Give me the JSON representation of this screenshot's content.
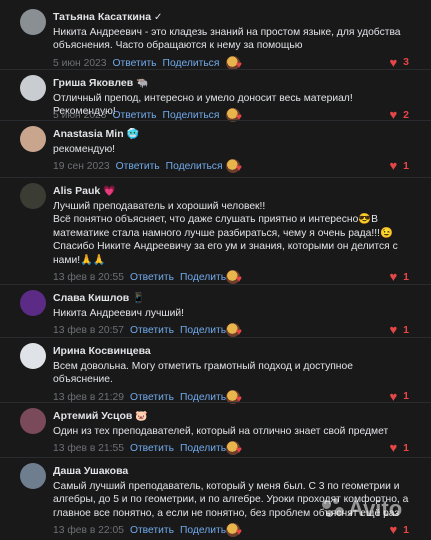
{
  "actions": {
    "reply": "Ответить",
    "share": "Поделиться"
  },
  "comments": [
    {
      "name": "Татьяна Касаткина",
      "name_emoji": "✓",
      "text": [
        "Никита Андреевич - это кладезь знаний на простом языке, для удобства",
        "объяснения. Часто обращаются к нему за помощью"
      ],
      "date": "5 июн 2023",
      "likes": "3",
      "avatar_color": "#8a8f94"
    },
    {
      "name": "Гриша Яковлев",
      "name_emoji": "🐃",
      "text": [
        "Отличный препод, интересно и умело доносит весь материал! Рекомендую!"
      ],
      "date": "5 июн 2023",
      "likes": "2",
      "avatar_color": "#c9cdd2"
    },
    {
      "name": "Anastasia Min",
      "name_emoji": "🥶",
      "text": [
        "рекомендую!"
      ],
      "date": "19 сен 2023",
      "likes": "1",
      "avatar_color": "#caa58e"
    },
    {
      "name": "Alis Pauk",
      "name_emoji": "💗",
      "text": [
        "Лучший преподаватель и хороший человек!!",
        "Всё понятно объясняет, что даже слушать приятно и интересно😎В",
        "математике стала намного лучше разбираться, чему я очень рада!!!😉",
        "Спасибо Никите Андреевичу за его ум и знания, которыми он делится с",
        "нами!🙏🙏"
      ],
      "date": "13 фев в 20:55",
      "likes": "1",
      "avatar_color": "#3b3d34"
    },
    {
      "name": "Слава Кишлов",
      "name_emoji": "📱",
      "text": [
        "Никита Андреевич лучший!"
      ],
      "date": "13 фев в 20:57",
      "likes": "1",
      "avatar_color": "#5b2b86"
    },
    {
      "name": "Ирина Косвинцева",
      "name_emoji": "",
      "text": [
        "Всем довольна. Могу отметить грамотный подход и доступное",
        "объяснение."
      ],
      "date": "13 фев в 21:29",
      "likes": "1",
      "avatar_color": "#dfe3e8"
    },
    {
      "name": "Артемий Усцов",
      "name_emoji": "🐷",
      "text": [
        "Один из тех преподавателей, который на отлично знает свой предмет"
      ],
      "date": "13 фев в 21:55",
      "likes": "1",
      "avatar_color": "#7a4a5a"
    },
    {
      "name": "Даша Ушакова",
      "name_emoji": "",
      "text": [
        "Самый лучший преподаватель, который у меня был. С 3 по геометрии и",
        "алгебры, до 5 и по геометрии, и по алгебре. Уроки проходят комфортно, а",
        "главное все понятно, а если не понятно, без проблем объяснят ещё раз"
      ],
      "date": "13 фев в 22:05",
      "likes": "1",
      "avatar_color": "#6f7e8e"
    }
  ],
  "watermark": {
    "brand": "Avito"
  }
}
